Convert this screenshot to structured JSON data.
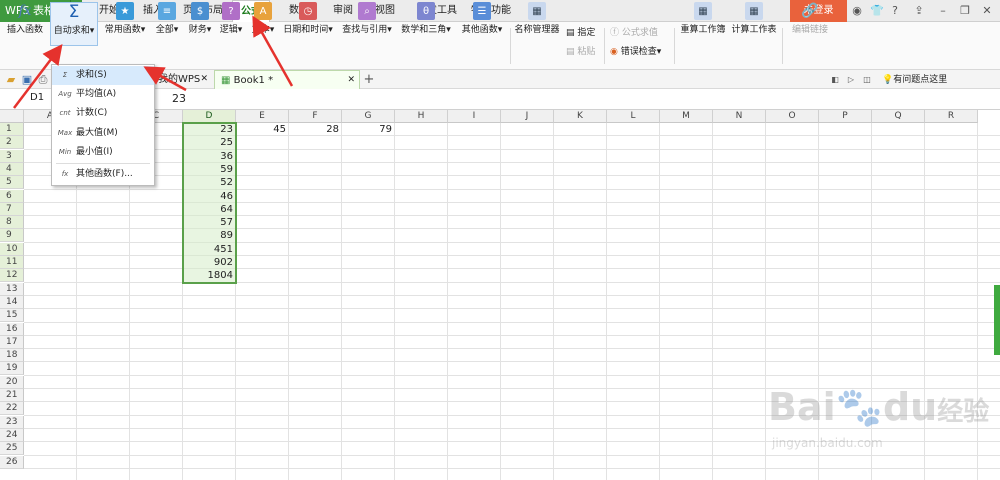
{
  "app": {
    "logo": "WPS 表格",
    "login": "未登录"
  },
  "menu_tabs": [
    {
      "label": "开始"
    },
    {
      "label": "插入"
    },
    {
      "label": "页面布局"
    },
    {
      "label": "公式"
    },
    {
      "label": "数据"
    },
    {
      "label": "审阅"
    },
    {
      "label": "视图"
    },
    {
      "label": "开发工具"
    },
    {
      "label": "特色功能"
    }
  ],
  "active_tab": "公式",
  "ribbon": {
    "insert_function": "插入函数",
    "autosum": "自动求和",
    "common_functions": "常用函数",
    "all": "全部",
    "financial": "财务",
    "logical": "逻辑",
    "text": "文本",
    "datetime": "日期和时间",
    "lookup": "查找与引用",
    "math": "数学和三角",
    "other": "其他函数",
    "name_manager": "名称管理器",
    "specify": "指定",
    "paste": "粘贴",
    "formula_eval": "公式求值",
    "error_check": "错误检查",
    "recalc_workbook": "重算工作簿",
    "calc_sheet": "计算工作表",
    "edit_links": "编辑链接"
  },
  "doc_tabs": {
    "wps": "我的WPS",
    "book": "Book1 *"
  },
  "help_text": "有问题点这里",
  "name_box": "D1",
  "formula_content": "23",
  "columns": [
    "A",
    "B",
    "C",
    "D",
    "E",
    "F",
    "G",
    "H",
    "I",
    "J",
    "K",
    "L",
    "M",
    "N",
    "O",
    "P",
    "Q",
    "R"
  ],
  "rows": [
    "1",
    "2",
    "3",
    "4",
    "5",
    "6",
    "7",
    "8",
    "9",
    "10",
    "11",
    "12",
    "13",
    "14",
    "15",
    "16",
    "17",
    "18",
    "19",
    "20",
    "21",
    "22",
    "23",
    "24",
    "25",
    "26"
  ],
  "cells": {
    "D": [
      "23",
      "25",
      "36",
      "59",
      "52",
      "46",
      "64",
      "57",
      "89",
      "451",
      "902",
      "1804"
    ],
    "E1": "45",
    "F1": "28",
    "G1": "79"
  },
  "dropdown": [
    {
      "icon": "Σ",
      "label": "求和(S)"
    },
    {
      "icon": "Avg",
      "label": "平均值(A)"
    },
    {
      "icon": "cnt",
      "label": "计数(C)"
    },
    {
      "icon": "Max",
      "label": "最大值(M)"
    },
    {
      "icon": "Min",
      "label": "最小值(I)"
    },
    {
      "icon": "fx",
      "label": "其他函数(F)..."
    }
  ],
  "watermark": {
    "brand": "Bai",
    "brand2": "du",
    "jingyan": "经验",
    "url": "jingyan.baidu.com"
  },
  "colors": {
    "accent_green": "#3f9a3f",
    "login_orange": "#e9623c",
    "arrow_red": "#e5322d",
    "selection_green": "#5aa04a"
  }
}
